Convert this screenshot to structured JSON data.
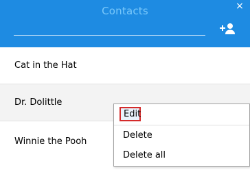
{
  "header": {
    "title": "Contacts",
    "search_value": "",
    "close_glyph": "×",
    "add_contact_icon": "add-person-icon",
    "bg_color": "#1e8be2"
  },
  "contacts": [
    {
      "name": "Cat in the Hat"
    },
    {
      "name": "Dr. Dolittle"
    },
    {
      "name": "Winnie the Pooh"
    }
  ],
  "context_menu": {
    "items": [
      {
        "label": "Edit"
      },
      {
        "label": "Delete"
      },
      {
        "label": "Delete all"
      }
    ],
    "highlight_color": "#d42a2a"
  }
}
